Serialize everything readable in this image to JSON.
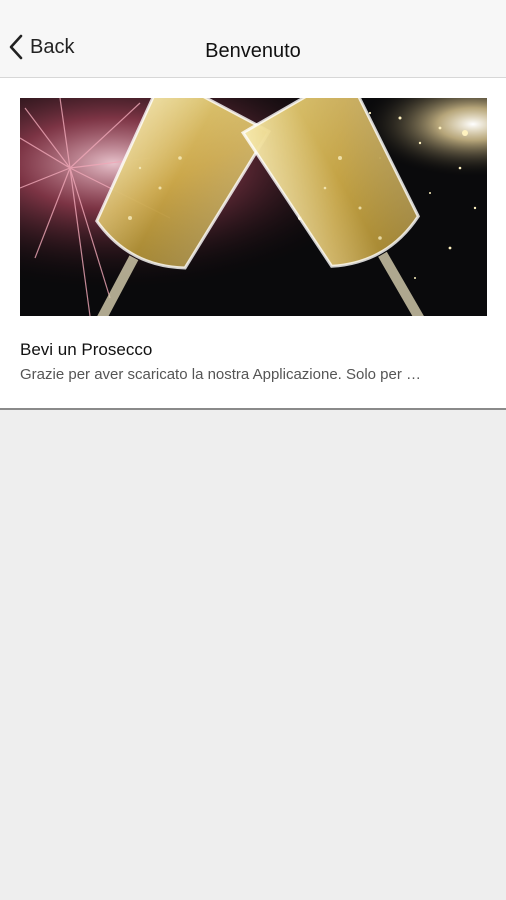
{
  "header": {
    "back_label": "Back",
    "title": "Benvenuto"
  },
  "post": {
    "title": "Bevi un Prosecco",
    "excerpt": "Grazie per aver scaricato la nostra Applicazione.  Solo per …"
  },
  "colors": {
    "navbar_bg": "#f7f7f7",
    "page_bg": "#eeeeee",
    "card_bg": "#ffffff"
  },
  "icons": {
    "back": "chevron-left-icon"
  }
}
